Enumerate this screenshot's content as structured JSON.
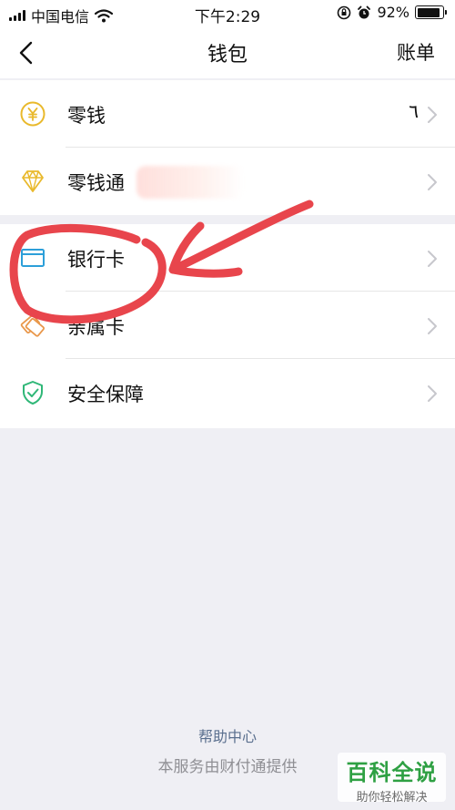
{
  "status_bar": {
    "carrier": "中国电信",
    "time": "下午2:29",
    "battery": "92%",
    "battery_level": 0.92
  },
  "nav": {
    "title": "钱包",
    "right_label": "账单"
  },
  "groups": [
    {
      "rows": [
        {
          "label": "零钱",
          "value": "٦",
          "icon": "yuan-coin-icon"
        },
        {
          "label": "零钱通",
          "icon": "diamond-icon"
        }
      ]
    },
    {
      "rows": [
        {
          "label": "银行卡",
          "icon": "bank-card-icon"
        },
        {
          "label": "亲属卡",
          "icon": "family-card-icon"
        },
        {
          "label": "安全保障",
          "icon": "shield-check-icon"
        }
      ]
    }
  ],
  "footer": {
    "help_center": "帮助中心",
    "provider": "本服务由财付通提供"
  },
  "watermark": {
    "title": "百科全说",
    "subtitle": "助你轻松解决"
  },
  "colors": {
    "accent_yellow": "#e9b92c",
    "card_blue": "#2c9fd9",
    "family_orange": "#e9974a",
    "shield_green": "#2fb777",
    "annotation_red": "#e8454c",
    "watermark_green": "#2ea043"
  }
}
